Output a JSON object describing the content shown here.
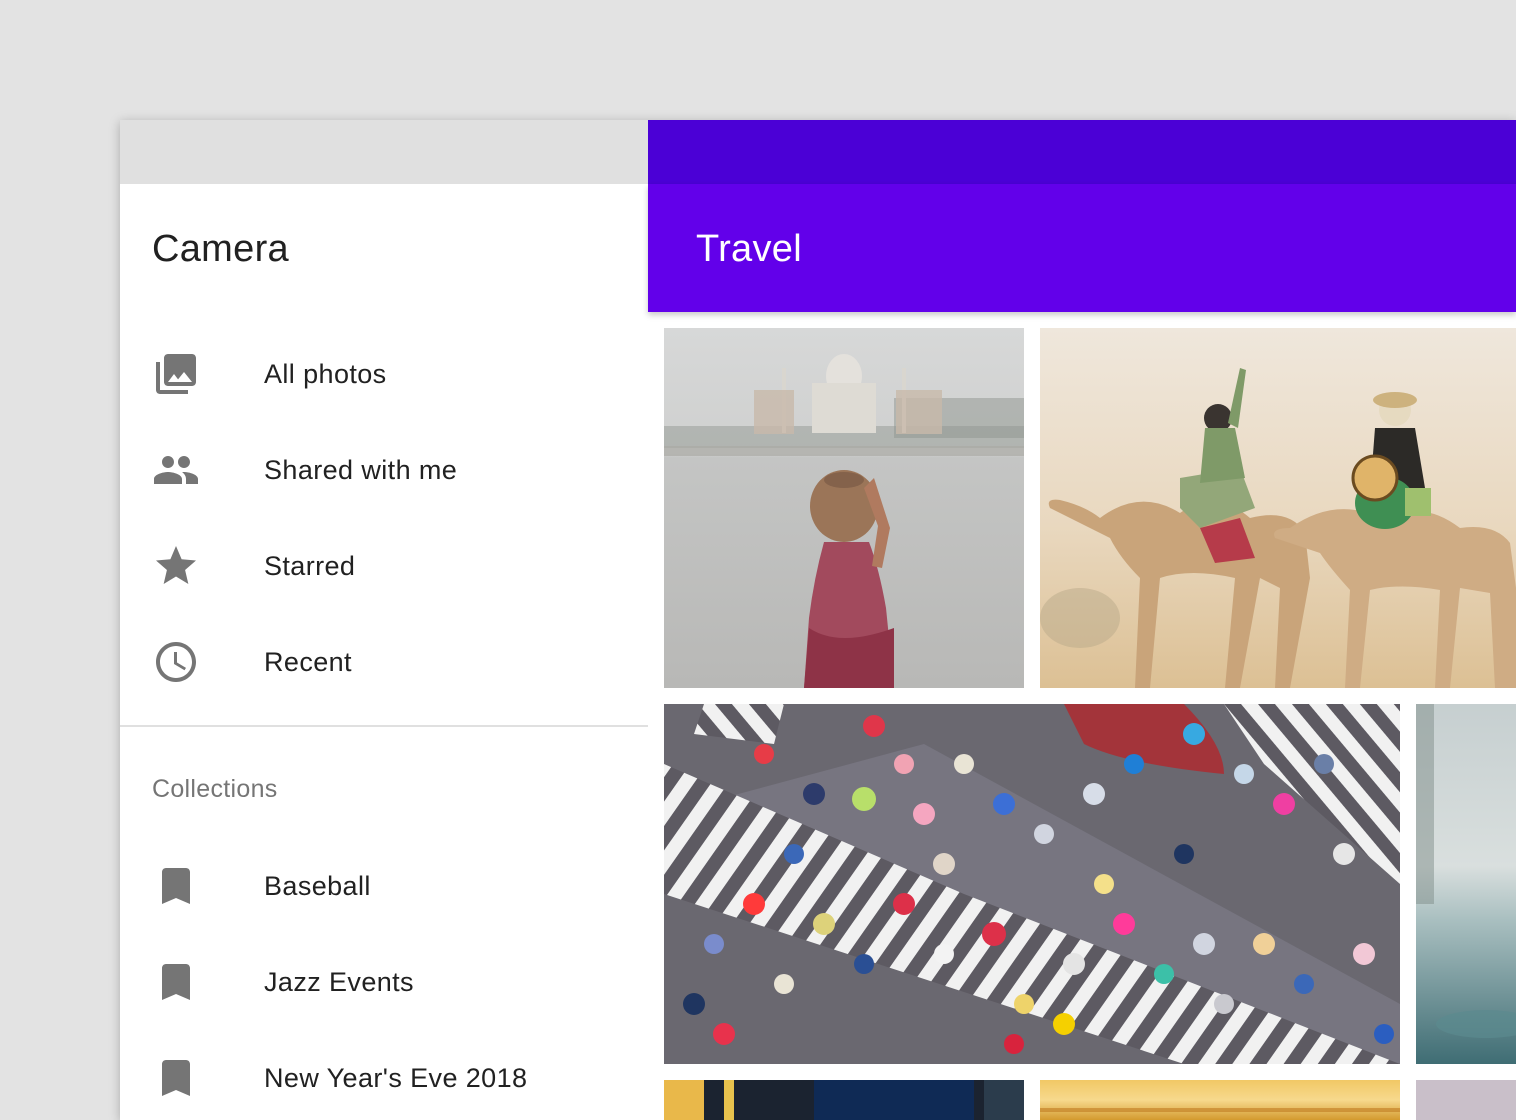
{
  "drawer": {
    "title": "Camera",
    "nav_items": [
      {
        "label": "All photos",
        "icon": "photo-library-icon"
      },
      {
        "label": "Shared with me",
        "icon": "people-icon"
      },
      {
        "label": "Starred",
        "icon": "star-icon"
      },
      {
        "label": "Recent",
        "icon": "clock-icon"
      }
    ],
    "collections_header": "Collections",
    "collections": [
      {
        "label": "Baseball",
        "icon": "bookmark-icon"
      },
      {
        "label": "Jazz Events",
        "icon": "bookmark-icon"
      },
      {
        "label": "New Year's Eve 2018",
        "icon": "bookmark-icon"
      }
    ]
  },
  "app_bar": {
    "title": "Travel"
  },
  "colors": {
    "primary": "#6200ea",
    "primary_dark": "#4b00d6",
    "icon_gray": "#757575"
  },
  "photos": [
    {
      "subject": "woman-with-pot-by-taj-mahal"
    },
    {
      "subject": "camel-riders-in-desert"
    },
    {
      "subject": "umbrellas-on-crosswalk"
    },
    {
      "subject": "misty-shore"
    },
    {
      "subject": "city-lights"
    },
    {
      "subject": "sunset-horizon"
    },
    {
      "subject": "lavender-sky"
    }
  ]
}
